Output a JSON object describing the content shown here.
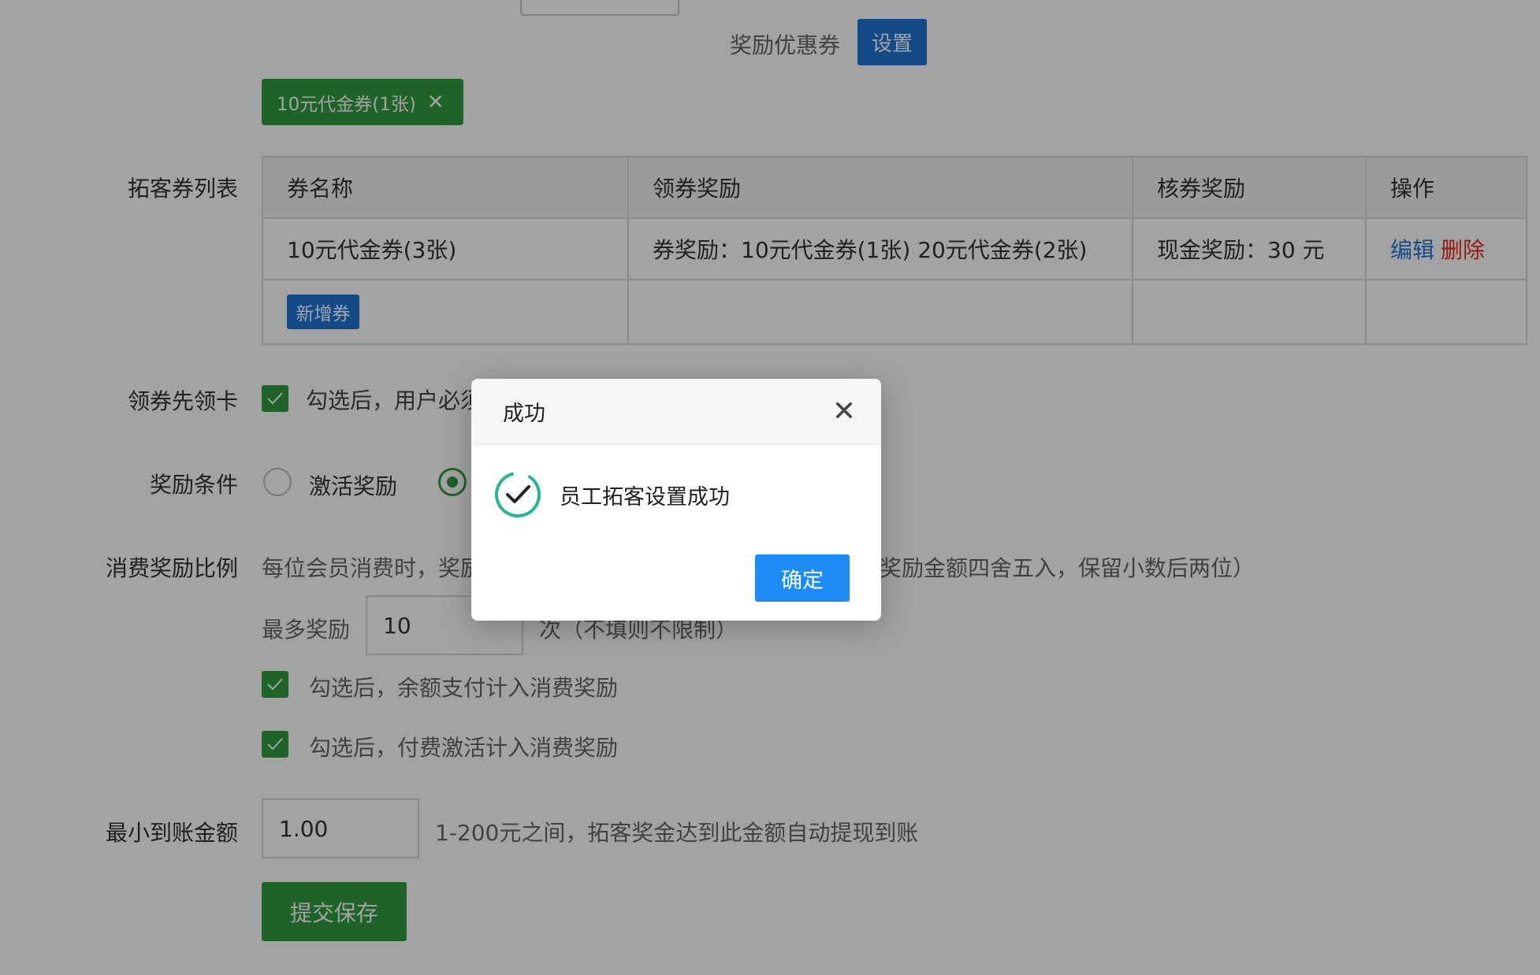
{
  "reward_coupon": {
    "label": "奖励优惠券",
    "set_button": "设置"
  },
  "selected_tag": {
    "text": "10元代金券(1张)",
    "remove_glyph": "✕"
  },
  "coupon_list": {
    "label": "拓客券列表",
    "headers": [
      "券名称",
      "领券奖励",
      "核券奖励",
      "操作"
    ],
    "row": {
      "name": "10元代金券(3张)",
      "claim_reward": "券奖励：10元代金券(1张) 20元代金券(2张)",
      "verify_reward": "现金奖励：30 元",
      "edit": "编辑",
      "delete": "删除"
    },
    "add_button": "新增券"
  },
  "claim_first": {
    "label": "领券先领卡",
    "text": "勾选后，用户必须"
  },
  "reward_condition": {
    "label": "奖励条件",
    "option1": "激活奖励"
  },
  "consume_ratio": {
    "label": "消费奖励比例",
    "text_left": "每位会员消费时，奖励",
    "text_right": "奖励金额四舍五入，保留小数后两位）",
    "max_label": "最多奖励",
    "max_value": "10",
    "max_hint": "次（不填则不限制）",
    "check1": "勾选后，余额支付计入消费奖励",
    "check2": "勾选后，付费激活计入消费奖励"
  },
  "min_amount": {
    "label": "最小到账金额",
    "value": "1.00",
    "hint": "1-200元之间，拓客奖金达到此金额自动提现到账"
  },
  "submit_button": "提交保存",
  "dialog": {
    "title": "成功",
    "close_glyph": "✕",
    "message": "员工拓客设置成功",
    "ok_button": "确定"
  },
  "colors": {
    "primary_blue": "#1e76d6",
    "green": "#2f9b3f",
    "danger": "#e0301e",
    "dialog_ok": "#1e8cf7"
  }
}
